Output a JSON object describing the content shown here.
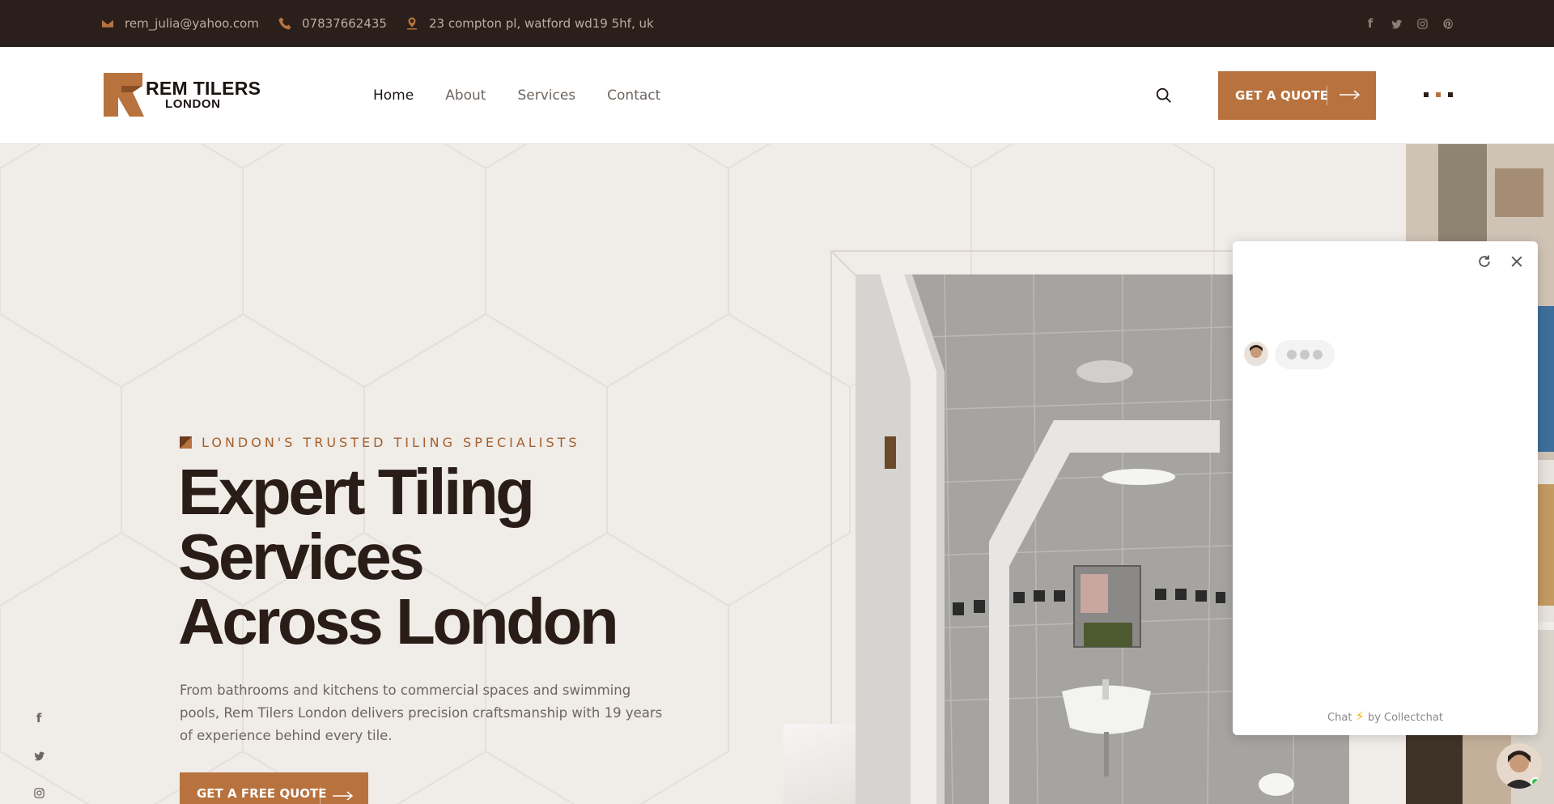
{
  "topbar": {
    "email": "rem_julia@yahoo.com",
    "phone": "07837662435",
    "address": "23 compton pl, watford wd19 5hf, uk",
    "social_icons": [
      "facebook-icon",
      "twitter-icon",
      "instagram-icon",
      "pinterest-icon"
    ]
  },
  "header": {
    "logo": {
      "line1": "REM TILERS",
      "line2": "LONDON"
    },
    "nav": [
      "Home",
      "About",
      "Services",
      "Contact"
    ],
    "active_nav": "Home",
    "quote_button": "GET A QUOTE"
  },
  "hero": {
    "tagline": "LONDON'S TRUSTED TILING SPECIALISTS",
    "heading_lines": [
      "Expert Tiling",
      "Services",
      "Across London"
    ],
    "description": "From bathrooms and kitchens to commercial spaces and swimming pools, Rem Tilers London delivers precision craftsmanship with 19 years of experience behind every tile.",
    "cta_button": "GET A FREE QUOTE"
  },
  "chat": {
    "footer_prefix": "Chat",
    "footer_suffix": "by Collectchat"
  },
  "colors": {
    "accent": "#b8723e",
    "topbar_bg": "#2a1f1a",
    "hero_bg": "#f0ece8",
    "heading": "#2a1d17"
  }
}
